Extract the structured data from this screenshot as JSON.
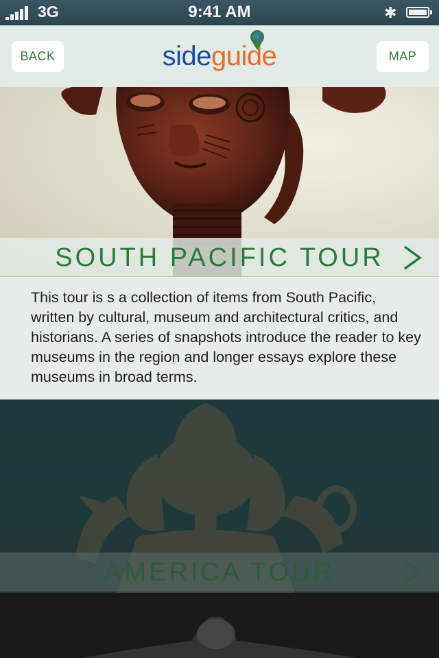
{
  "status_bar": {
    "carrier": "3G",
    "time": "9:41 AM",
    "bluetooth_icon": "bluetooth-icon",
    "battery_icon": "battery-icon"
  },
  "header": {
    "back_label": "BACK",
    "map_label": "MAP",
    "logo_part1": "side",
    "logo_part2": "guide",
    "logo_colors": {
      "side": "#1c4d9a",
      "guide": "#e96d2a"
    }
  },
  "tours": [
    {
      "title": "SOUTH PACIFIC TOUR",
      "description": "This  tour is s a collection of items from South Pacific, written by cultural, museum and architectural critics, and historians. A series of snapshots introduce the reader to key museums in the region and longer essays explore these museums in broad terms.",
      "image": "carved-wooden-head-sculpture",
      "chevron_icon": "chevron-right-icon"
    },
    {
      "title": "AMERICA TOUR",
      "image": "bronze-ganesha-statue",
      "chevron_icon": "chevron-right-icon"
    },
    {
      "image": "dark-artifact-partial"
    }
  ],
  "colors": {
    "accent_green": "#2a7a3b",
    "header_bg": "#e2ebe7",
    "status_bar_bg": "#345059"
  }
}
